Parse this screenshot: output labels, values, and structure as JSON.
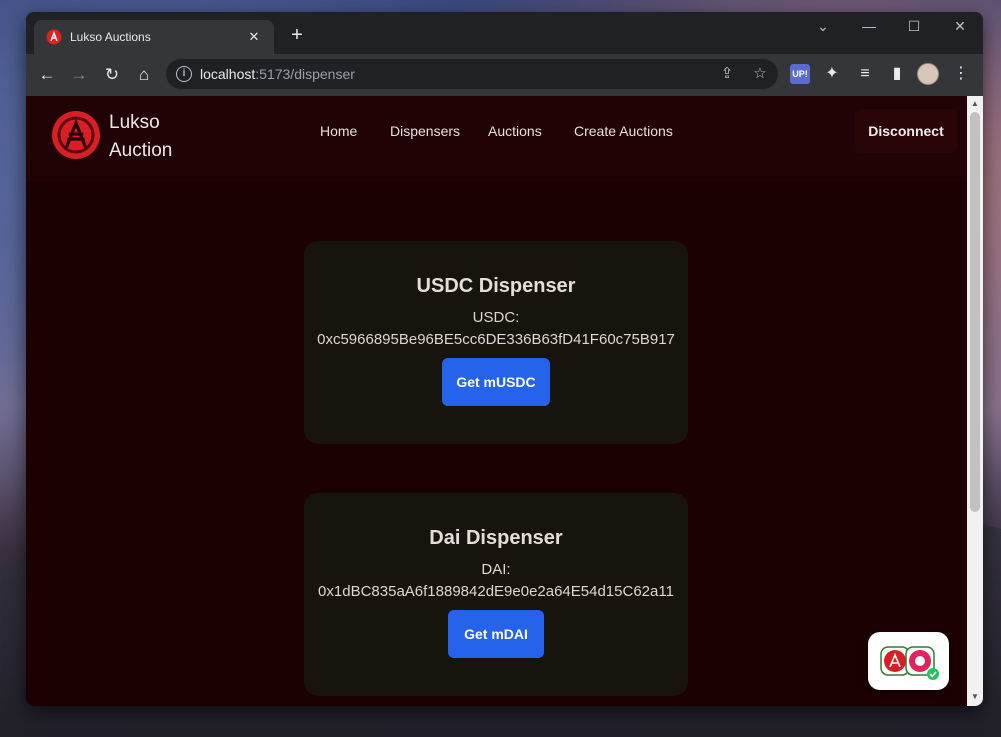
{
  "browser": {
    "tab_title": "Lukso Auctions",
    "tab_close": "✕",
    "new_tab": "+",
    "url_host": "localhost",
    "url_rest": ":5173/dispenser",
    "ext_up_label": "UP!"
  },
  "app": {
    "brand_line1": "Lukso",
    "brand_line2": "Auction",
    "nav": [
      "Home",
      "Dispensers",
      "Auctions",
      "Create Auctions"
    ],
    "disconnect_label": "Disconnect",
    "accent_color": "#2563eb"
  },
  "dispensers": [
    {
      "title": "USDC Dispenser",
      "token_label": "USDC:",
      "address": "0xc5966895Be96BE5cc6DE336B63fD41F60c75B917",
      "button_label": "Get mUSDC"
    },
    {
      "title": "Dai Dispenser",
      "token_label": "DAI:",
      "address": "0x1dBC835aA6f1889842dE9e0e2a64E54d15C62a11",
      "button_label": "Get mDAI"
    }
  ]
}
